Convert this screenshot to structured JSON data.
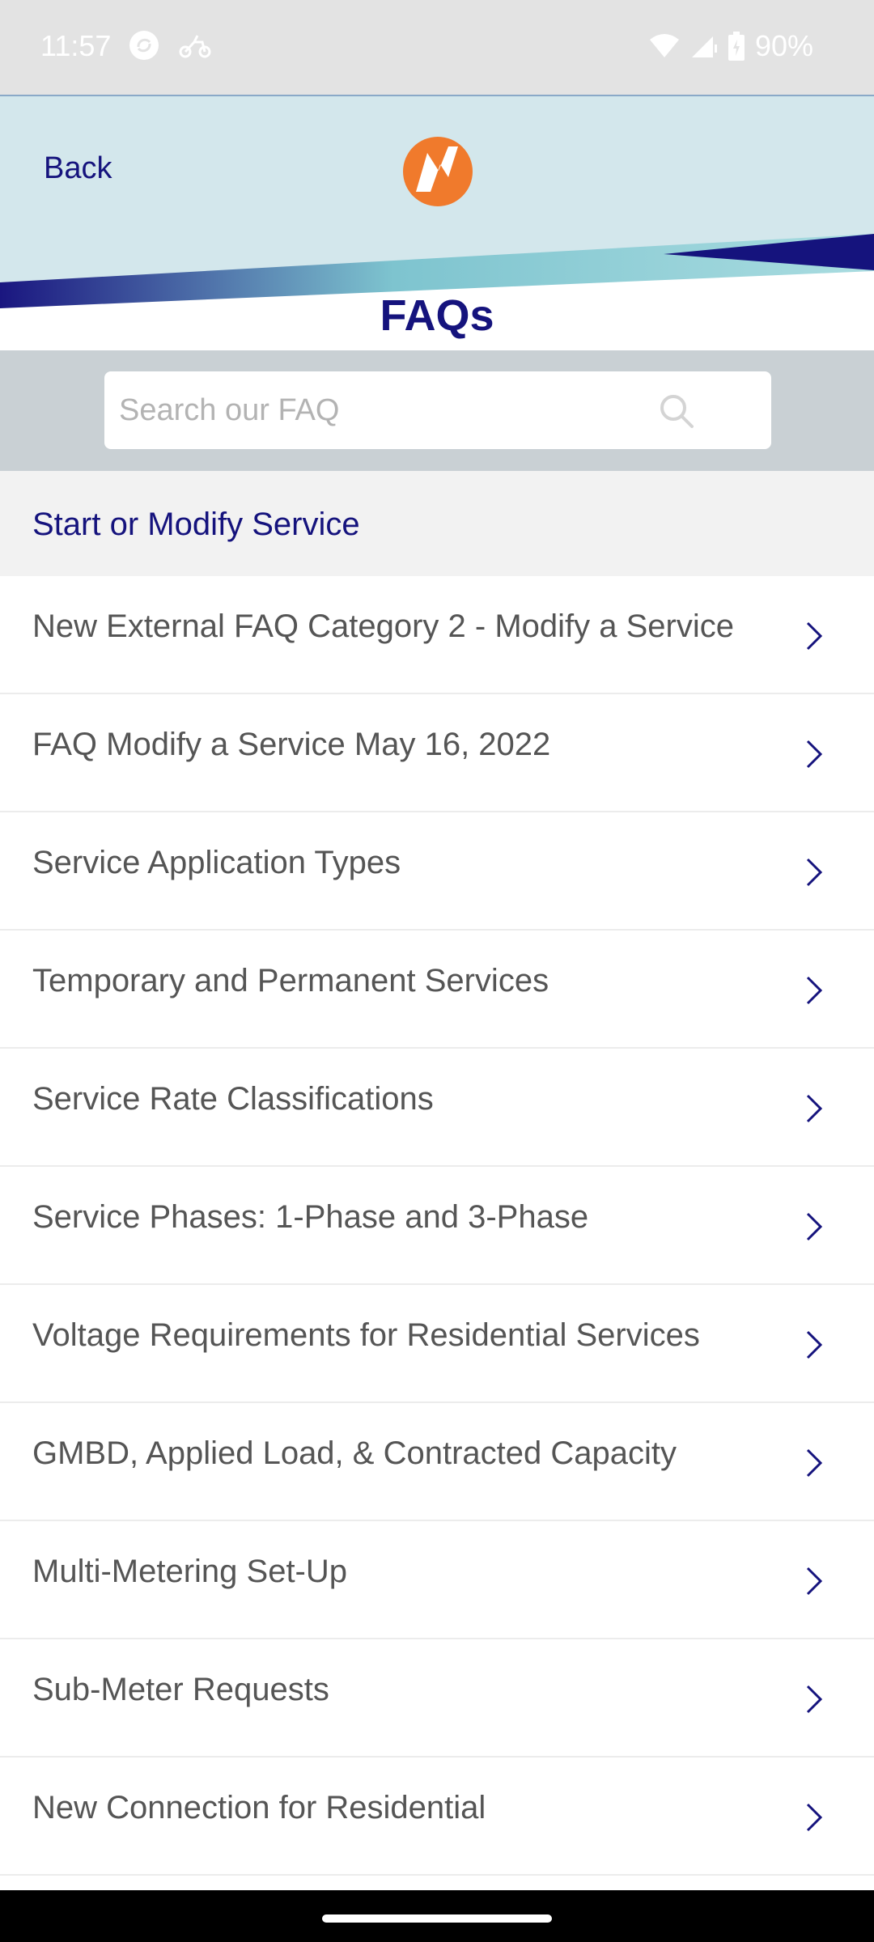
{
  "status_bar": {
    "time": "11:57",
    "battery": "90%",
    "icons": [
      "sync-icon",
      "scooter-icon",
      "wifi-icon",
      "signal-icon",
      "battery-icon"
    ]
  },
  "header": {
    "back_label": "Back",
    "title": "FAQs",
    "colors": {
      "brand_navy": "#15137d",
      "logo_orange": "#f07a2c",
      "header_bg": "#d3e7ec",
      "stripe_teal": "#7ec4cf"
    }
  },
  "search": {
    "placeholder": "Search our FAQ",
    "value": ""
  },
  "section": {
    "title": "Start or Modify Service"
  },
  "faq_items": [
    {
      "label": "New External FAQ Category 2 - Modify a Service"
    },
    {
      "label": "FAQ Modify a Service May 16, 2022"
    },
    {
      "label": "Service Application Types"
    },
    {
      "label": "Temporary and Permanent Services"
    },
    {
      "label": "Service Rate Classifications"
    },
    {
      "label": "Service Phases: 1-Phase and 3-Phase"
    },
    {
      "label": "Voltage Requirements for Residential Services"
    },
    {
      "label": "GMBD, Applied Load, & Contracted Capacity"
    },
    {
      "label": "Multi-Metering Set-Up"
    },
    {
      "label": "Sub-Meter Requests"
    },
    {
      "label": "New Connection for Residential"
    }
  ]
}
